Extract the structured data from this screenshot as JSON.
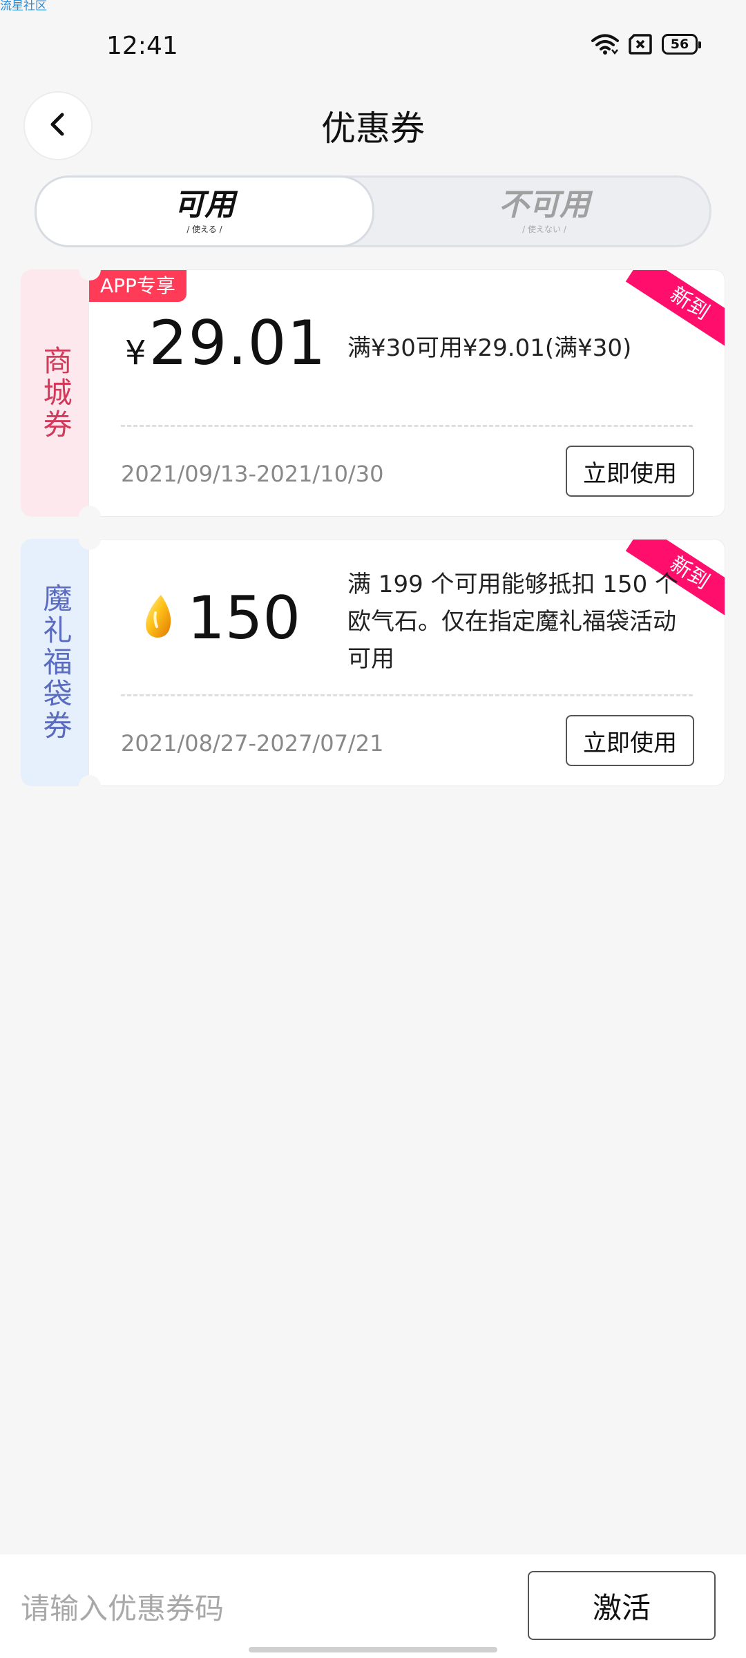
{
  "watermark": "流星社区",
  "status_bar": {
    "time": "12:41",
    "battery": "56",
    "icons": [
      "wifi-icon",
      "sim-icon",
      "battery-icon"
    ]
  },
  "header": {
    "title": "优惠券",
    "back_icon": "chevron-left-icon"
  },
  "tabs": [
    {
      "label": "可用",
      "sub": "/ 使える /",
      "active": true
    },
    {
      "label": "不可用",
      "sub": "/ 使えない /",
      "active": false
    }
  ],
  "coupons": [
    {
      "side_label": "商城券",
      "badge": "APP专享",
      "ribbon": "新到",
      "currency": "¥",
      "amount": "29.01",
      "description": "满¥30可用¥29.01(满¥30)",
      "date_range": "2021/09/13-2021/10/30",
      "button": "立即使用"
    },
    {
      "side_label": "魔礼福袋券",
      "ribbon": "新到",
      "amount": "150",
      "icon": "gem-icon",
      "description": "满 199 个可用能够抵扣 150 个欧气石。仅在指定魔礼福袋活动可用",
      "date_range": "2021/08/27-2027/07/21",
      "button": "立即使用"
    }
  ],
  "bottom_bar": {
    "input_placeholder": "请输入优惠券码",
    "activate_button": "激活"
  },
  "colors": {
    "background": "#f6f6f6",
    "mall_side_bg": "#fde8ee",
    "mall_side_text": "#d23a5a",
    "lucky_side_bg": "#e6f0fd",
    "lucky_side_text": "#5b6bbf",
    "ribbon": "#ff0f6b",
    "badge": "#ff3b57"
  }
}
